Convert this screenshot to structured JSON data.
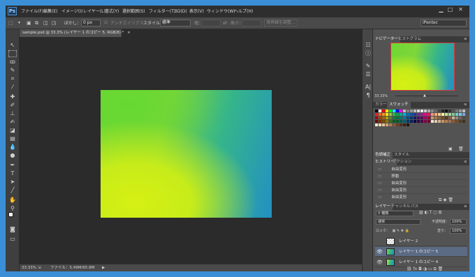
{
  "app": {
    "logo": "Ps",
    "window_controls": [
      "▁",
      "□",
      "✕"
    ]
  },
  "menubar": [
    "ファイル(F)",
    "編集(E)",
    "イメージ(I)",
    "レイヤー(L)",
    "書式(Y)",
    "選択範囲(S)",
    "フィルター(T)",
    "3D(D)",
    "表示(V)",
    "ウィンドウ(W)",
    "ヘルプ(H)"
  ],
  "options": {
    "feather_label": "ぼかし：",
    "feather_value": "0 px",
    "antialias_label": "アンチエイリアス",
    "style_label": "スタイル：",
    "style_value": "標準",
    "width_label": "幅：",
    "height_label": "高さ：",
    "refine_edge": "境界線を調整...",
    "workspace": "iPentec"
  },
  "document": {
    "tab_label": "sample.psd @ 33.3% (レイヤー 1 のコピー 5, RGB/8) *",
    "zoom": "33.33%",
    "file_info": "ファイル：5.49M/65.8M"
  },
  "navigator": {
    "tabs": [
      "ナビゲーター",
      "ヒストグラム"
    ],
    "zoom": "33.33%"
  },
  "color_panel": {
    "tabs": [
      "カラー",
      "スウォッチ"
    ]
  },
  "adjust_panel": {
    "tabs": [
      "色調補正",
      "スタイル"
    ]
  },
  "history_panel": {
    "tabs": [
      "ヒストリー",
      "アクション"
    ],
    "items": [
      "自由変形",
      "移動",
      "自由変形",
      "自由変形",
      "自由変形"
    ]
  },
  "layers_panel": {
    "tabs": [
      "レイヤー",
      "チャンネル",
      "パス"
    ],
    "filter_kind": "種類",
    "blend_mode": "通常",
    "opacity_label": "不透明度：",
    "opacity_value": "100%",
    "lock_label": "ロック：",
    "fill_label": "塗り：",
    "fill_value": "100%",
    "layers": [
      {
        "name": "レイヤー 2",
        "selected": false
      },
      {
        "name": "レイヤー 1 のコピー 5",
        "selected": true
      },
      {
        "name": "レイヤー 1 のコピー 4",
        "selected": false
      }
    ]
  },
  "colors": {
    "accent": "#3a8fd6",
    "selected_layer": "#5c6b84",
    "ui_bg": "#535353"
  }
}
